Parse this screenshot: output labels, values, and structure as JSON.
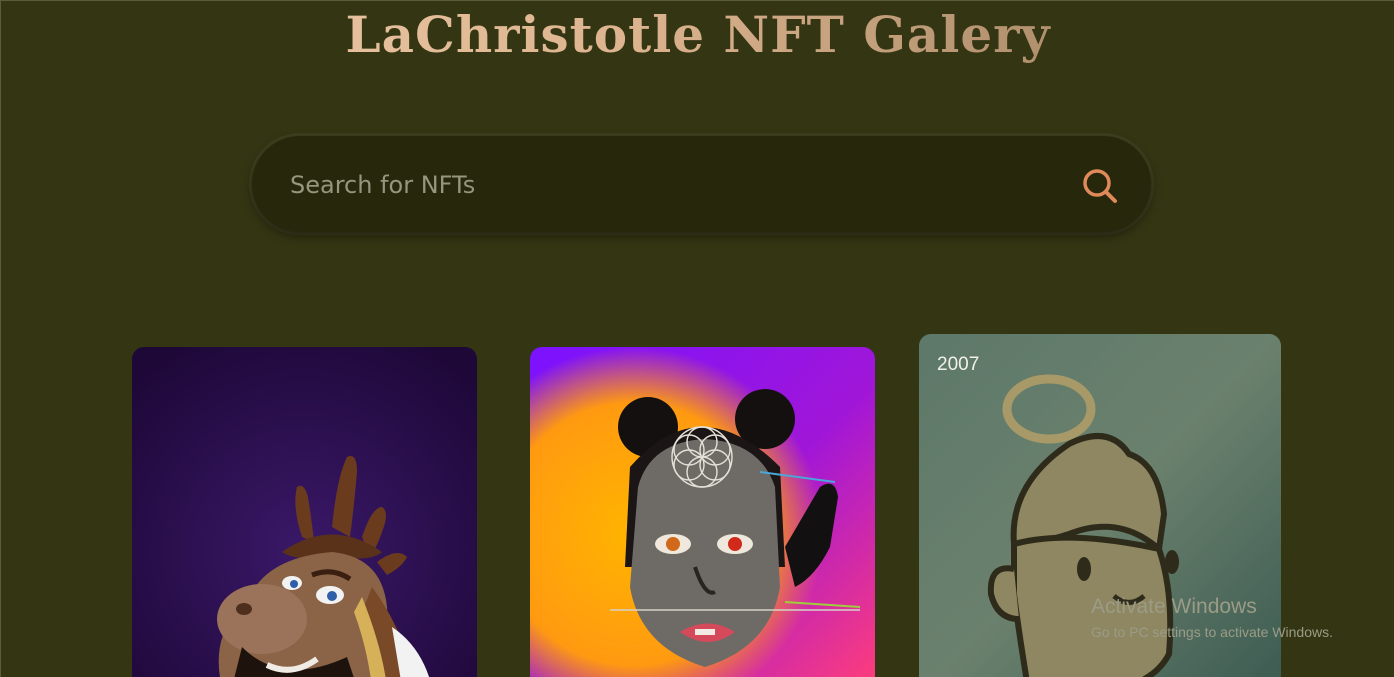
{
  "header": {
    "title": "LaChristotle NFT Galery"
  },
  "search": {
    "placeholder": "Search for NFTs",
    "icon": "search-icon",
    "accent_color": "#e08a5a"
  },
  "gallery": {
    "cards": [
      {
        "year": ""
      },
      {
        "year": ""
      },
      {
        "year": "2007"
      }
    ]
  },
  "watermark": {
    "title": "Activate Windows",
    "subtitle": "Go to PC settings to activate Windows."
  },
  "colors": {
    "background": "#343513",
    "search_bg": "#27270c",
    "title_gradient_start": "#f3cfae",
    "title_gradient_end": "#8d7251"
  }
}
